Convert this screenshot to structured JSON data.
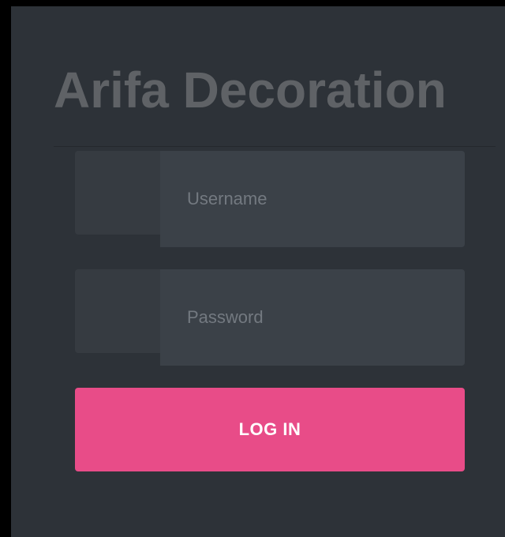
{
  "brand": {
    "title": "Arifa Decoration"
  },
  "login_form": {
    "username": {
      "placeholder": "Username",
      "value": ""
    },
    "password": {
      "placeholder": "Password",
      "value": ""
    },
    "submit_label": "LOG IN"
  },
  "colors": {
    "background": "#2d3238",
    "title_text": "#5f6266",
    "input_addon": "#363b41",
    "input_field": "#3b4148",
    "placeholder_text": "#737980",
    "accent_button": "#e84c88",
    "button_text": "#ffffff"
  }
}
